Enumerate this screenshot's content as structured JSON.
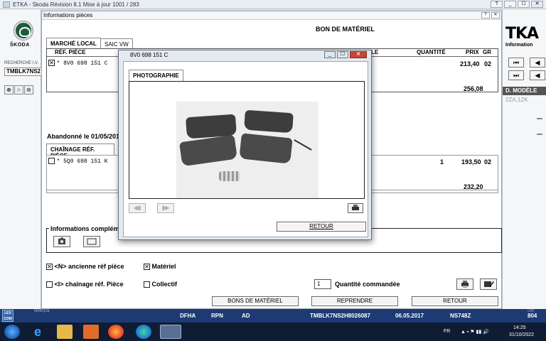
{
  "window": {
    "title": "ETKA - Skoda Révision 8.1 Mise à jour 1001 / 283",
    "buttons": [
      "?",
      "_",
      "☐",
      "✕"
    ]
  },
  "left_panel": {
    "brand": "ŠKODA",
    "search_label": "RECHERCHE I.V.",
    "search_value": "TMBLK7NS2"
  },
  "right_panel": {
    "logo": "TKA",
    "logo_sub": "Information",
    "modele_header": "D. MODÈLE",
    "modele_value": "2ZA,1ZK"
  },
  "dialog": {
    "title": "Informations pièces",
    "heading": "BON DE MATÉRIEL",
    "tabs": [
      "MARCHÉ LOCAL",
      "SAIC VW"
    ],
    "columns": {
      "ref": "RÉF. PIÈCE",
      "designation_tail": "LE",
      "qty": "QUANTITÉ",
      "price": "PRIX",
      "gr": "GR"
    },
    "row1": {
      "check": "✕",
      "ref": "* 8V0 698 151 C",
      "price": "213,40",
      "gr": "02"
    },
    "subtotal1": "256,08",
    "abandon_note": "Abandonné le 01/05/2019,",
    "chain_tab": "CHAÎNAGE RÉF. PIÈCE",
    "row2": {
      "ref": "* 5Q0 698 151 K",
      "qty": "1",
      "price": "193,50",
      "gr": "02"
    },
    "subtotal2": "232,20",
    "info_label": "Informations complém",
    "opt_ancienne": "<N> ancienne réf pièce",
    "opt_materiel": "Matériel",
    "opt_chainage": "<I> chaînage réf. Pièce",
    "opt_collectif": "Collectif",
    "qty_value": "1",
    "qty_label": "Quantité commandée",
    "btn_bons": "BONS DE MATÉRIEL",
    "btn_reprendre": "REPRENDRE",
    "btn_retour": "RETOUR"
  },
  "popup": {
    "title": "8V0 698 151 C",
    "tab": "PHOTOGRAPHIE",
    "retour": "RETOUR"
  },
  "status": {
    "lex": "LEX COM",
    "fields": [
      {
        "label": "MARQUE",
        "value": ""
      },
      {
        "label": "",
        "value": "DFHA"
      },
      {
        "label": "",
        "value": "RPN"
      },
      {
        "label": "",
        "value": "AD"
      },
      {
        "label": "",
        "value": "TMBLK7NS2H8026087"
      },
      {
        "label": "",
        "value": "06.05.2017"
      },
      {
        "label": "",
        "value": "NS748Z"
      },
      {
        "label": "CAT",
        "value": "804"
      }
    ]
  },
  "taskbar": {
    "lang": "FR",
    "time": "14:25",
    "date": "31/10/2022"
  }
}
